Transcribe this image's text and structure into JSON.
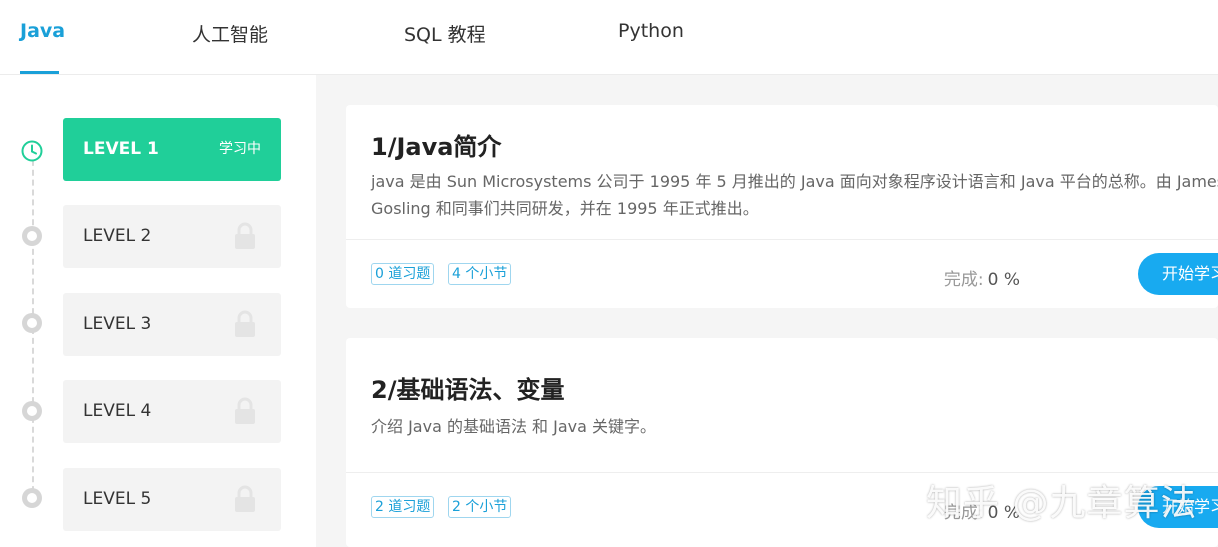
{
  "tabs": [
    {
      "label": "Java",
      "active": true
    },
    {
      "label": "人工智能",
      "active": false
    },
    {
      "label": "SQL 教程",
      "active": false
    },
    {
      "label": "Python",
      "active": false
    }
  ],
  "levels": [
    {
      "label": "LEVEL 1",
      "status": "学习中",
      "state": "current",
      "icon": "clock-icon"
    },
    {
      "label": "LEVEL 2",
      "state": "locked",
      "icon": "lock-icon"
    },
    {
      "label": "LEVEL 3",
      "state": "locked",
      "icon": "lock-icon"
    },
    {
      "label": "LEVEL 4",
      "state": "locked",
      "icon": "lock-icon"
    },
    {
      "label": "LEVEL 5",
      "state": "locked",
      "icon": "lock-icon"
    }
  ],
  "courses": [
    {
      "title": "1/Java简介",
      "description": "java 是由 Sun Microsystems 公司于 1995 年 5 月推出的 Java 面向对象程序设计语言和 Java 平台的总称。由 James Gosling 和同事们共同研发，并在 1995 年正式推出。",
      "exercises": "0 道习题",
      "sections": "4 个小节",
      "progress_label": "完成:",
      "progress_value": "0 %",
      "button": "开始学习"
    },
    {
      "title": "2/基础语法、变量",
      "description": "介绍 Java 的基础语法 和 Java 关键字。",
      "exercises": "2 道习题",
      "sections": "2 个小节",
      "progress_label": "完成:",
      "progress_value": "0 %",
      "button": "开始学习"
    }
  ],
  "watermark": "知乎 @九章算法",
  "colors": {
    "accent": "#1aa0d8",
    "level_active": "#20cf99",
    "button": "#18aaf0"
  }
}
